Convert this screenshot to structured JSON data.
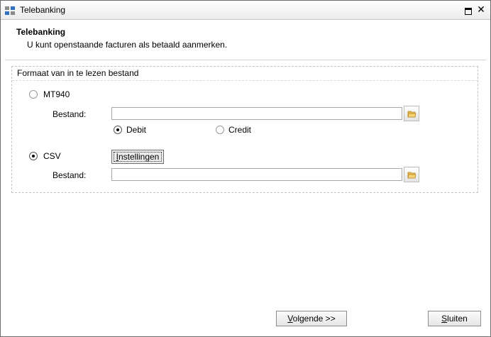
{
  "window": {
    "title": "Telebanking"
  },
  "header": {
    "title": "Telebanking",
    "subtitle": "U kunt openstaande facturen als betaald aanmerken."
  },
  "group": {
    "title": "Formaat van in te lezen bestand",
    "mt940": {
      "label": "MT940",
      "selected": false,
      "file_label": "Bestand:",
      "file_value": "",
      "debit_label": "Debit",
      "debit_selected": true,
      "credit_label": "Credit",
      "credit_selected": false
    },
    "csv": {
      "label": "CSV",
      "selected": true,
      "settings_mnemonic": "I",
      "settings_rest": "nstellingen",
      "file_label": "Bestand:",
      "file_value": ""
    }
  },
  "footer": {
    "next_mnemonic": "V",
    "next_rest": "olgende >>",
    "close_mnemonic": "S",
    "close_rest": "luiten"
  },
  "icons": {
    "app": "app-grid-icon",
    "restore": "restore-icon",
    "close": "close-icon",
    "browse": "folder-icon"
  },
  "colors": {
    "app_icon_blue": "#2f6fc4",
    "app_icon_gray": "#8a8a8a",
    "folder_yellow": "#e8b84a"
  }
}
